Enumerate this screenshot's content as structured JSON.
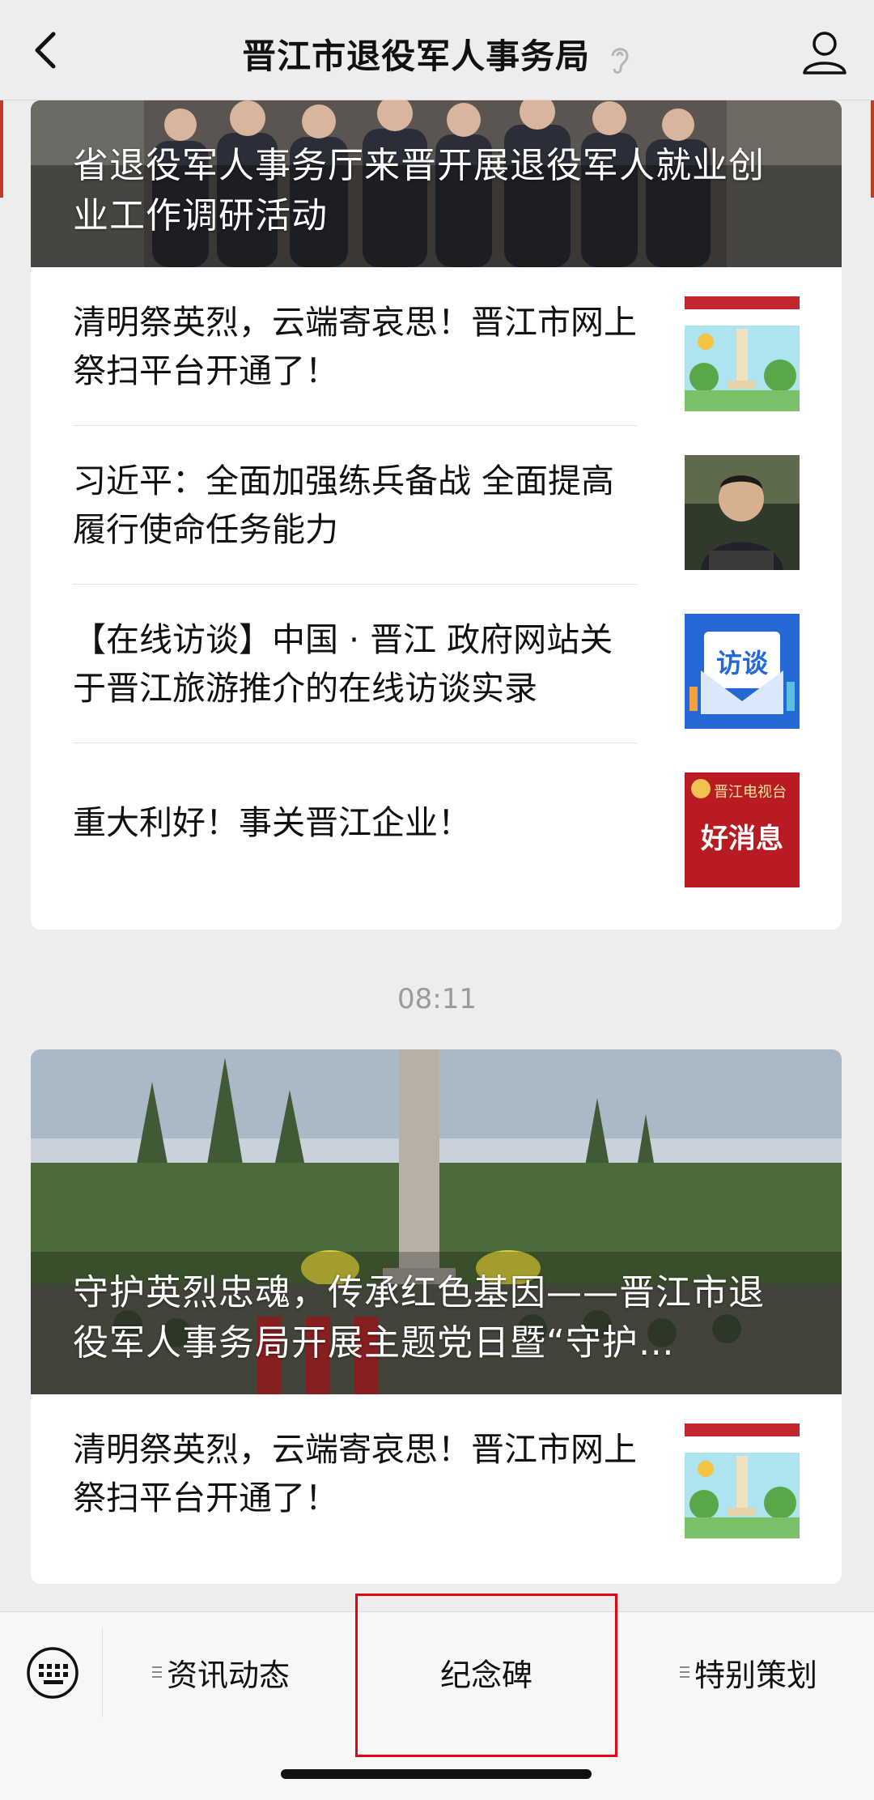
{
  "header": {
    "title": "晋江市退役军人事务局"
  },
  "card1": {
    "hero_title": "省退役军人事务厅来晋开展退役军人就业创业工作调研活动",
    "items": [
      {
        "text": "清明祭英烈，云端寄哀思！晋江市网上祭扫平台开通了！",
        "thumb": "monument-page-thumbnail"
      },
      {
        "text": "习近平：全面加强练兵备战 全面提高履行使命任务能力",
        "thumb": "speaker-portrait-thumbnail"
      },
      {
        "text": "【在线访谈】中国 · 晋江 政府网站关于晋江旅游推介的在线访谈实录",
        "thumb": "interview-envelope-thumbnail",
        "thumb_label": "访谈"
      },
      {
        "text": "重大利好！事关晋江企业！",
        "thumb": "good-news-thumbnail",
        "thumb_label": "好消息",
        "thumb_brand": "晋江电视台"
      }
    ]
  },
  "timestamp": "08:11",
  "card2": {
    "hero_title": "守护英烈忠魂，传承红色基因——晋江市退役军人事务局开展主题党日暨“守护…",
    "items": [
      {
        "text": "清明祭英烈，云端寄哀思！晋江市网上祭扫平台开通了！",
        "thumb": "monument-page-thumbnail"
      }
    ]
  },
  "bottom_menu": {
    "items": [
      "资讯动态",
      "纪念碑",
      "特别策划"
    ]
  },
  "colors": {
    "background": "#ededed",
    "highlight": "#e60012",
    "accent_red": "#b81c22"
  }
}
